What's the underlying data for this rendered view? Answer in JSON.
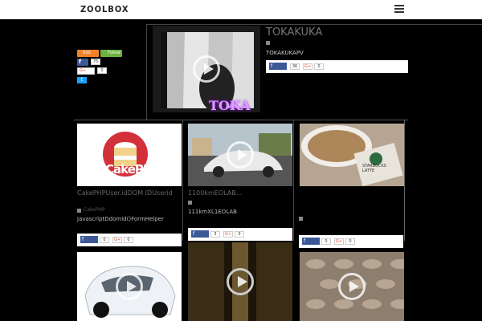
{
  "header": {
    "logo": "ZOOLBOX"
  },
  "sidebar": {
    "rss_label": "RSS",
    "follow_label": "Follow",
    "fb_label": "f",
    "fb_count": "75",
    "gplus_label": "G+",
    "gplus_count": "0",
    "tw_label": "t"
  },
  "feature": {
    "title": "TOKAKUKA",
    "tag": "TOKAKUKAPV",
    "image_caption": "TOKA",
    "fb_label": "f",
    "fb_count": "36",
    "gplus_label": "G+",
    "gplus_count": "0"
  },
  "cards": [
    {
      "title": "CakePHPUser.idDOM IDUserid",
      "tag": "CakePHP",
      "excerpt": "JavascriptDdomid()FormHelper",
      "fb_label": "f",
      "fb_count": "0",
      "gplus_label": "G+",
      "gplus_count": "0",
      "image_text": "CakePHP"
    },
    {
      "title": "1100kmEOLAB...",
      "tag": "",
      "excerpt": "111kmXL1EOLAB",
      "fb_label": "f",
      "fb_count": "3",
      "gplus_label": "G+",
      "gplus_count": "0"
    },
    {
      "title": "",
      "tag": "",
      "excerpt": "",
      "fb_label": "f",
      "fb_count": "0",
      "gplus_label": "G+",
      "gplus_count": "0",
      "image_text": "STARBUCKS LATTE"
    }
  ]
}
